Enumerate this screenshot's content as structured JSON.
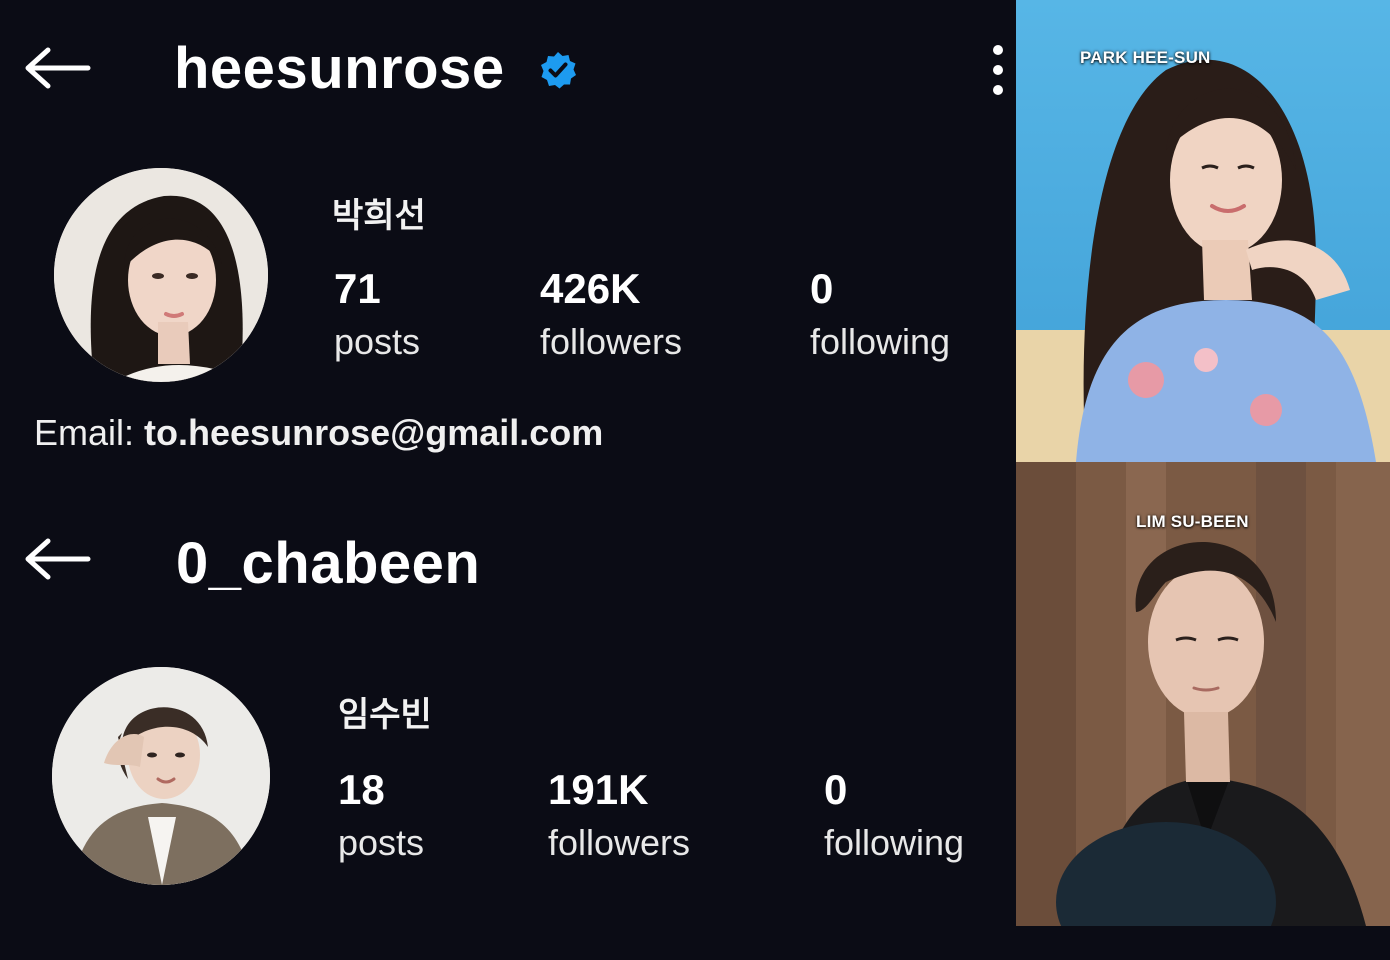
{
  "profiles": [
    {
      "username": "heesunrose",
      "verified": true,
      "display_name": "박희선",
      "stats": {
        "posts": {
          "value": "71",
          "label": "posts"
        },
        "followers": {
          "value": "426K",
          "label": "followers"
        },
        "following": {
          "value": "0",
          "label": "following"
        }
      },
      "email_label": "Email:",
      "email_value": "to.heesunrose@gmail.com"
    },
    {
      "username": "0_chabeen",
      "verified": false,
      "display_name": "임수빈",
      "stats": {
        "posts": {
          "value": "18",
          "label": "posts"
        },
        "followers": {
          "value": "191K",
          "label": "followers"
        },
        "following": {
          "value": "0",
          "label": "following"
        }
      }
    }
  ],
  "photos": [
    {
      "caption": "PARK HEE-SUN"
    },
    {
      "caption": "LIM SU-BEEN"
    }
  ],
  "icons": [
    "back-arrow-icon",
    "verified-badge-icon",
    "more-options-icon"
  ],
  "colors": {
    "background": "#0b0c15",
    "text": "#ffffff",
    "verified": "#1d9bf0"
  }
}
